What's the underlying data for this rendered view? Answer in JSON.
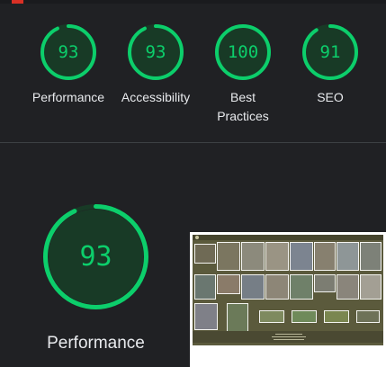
{
  "summary": {
    "gauges": [
      {
        "label": "Performance",
        "score": "93",
        "fraction": 0.93,
        "label_lines": [
          "Performance"
        ]
      },
      {
        "label": "Accessibility",
        "score": "93",
        "fraction": 0.93,
        "label_lines": [
          "Accessibility"
        ]
      },
      {
        "label": "Best Practices",
        "score": "100",
        "fraction": 1.0,
        "label_lines": [
          "Best",
          "Practices"
        ]
      },
      {
        "label": "SEO",
        "score": "91",
        "fraction": 0.91,
        "label_lines": [
          "SEO"
        ]
      }
    ]
  },
  "performance": {
    "score": "93",
    "fraction": 0.93,
    "title": "Performance"
  },
  "colors": {
    "background": "#202124",
    "pass": "#0cce6b",
    "pass_fill": "#183a26",
    "text": "#e8eaed",
    "divider": "#3c4043"
  },
  "screenshot": {
    "description_icon": "page-screenshot-thumbnail"
  }
}
